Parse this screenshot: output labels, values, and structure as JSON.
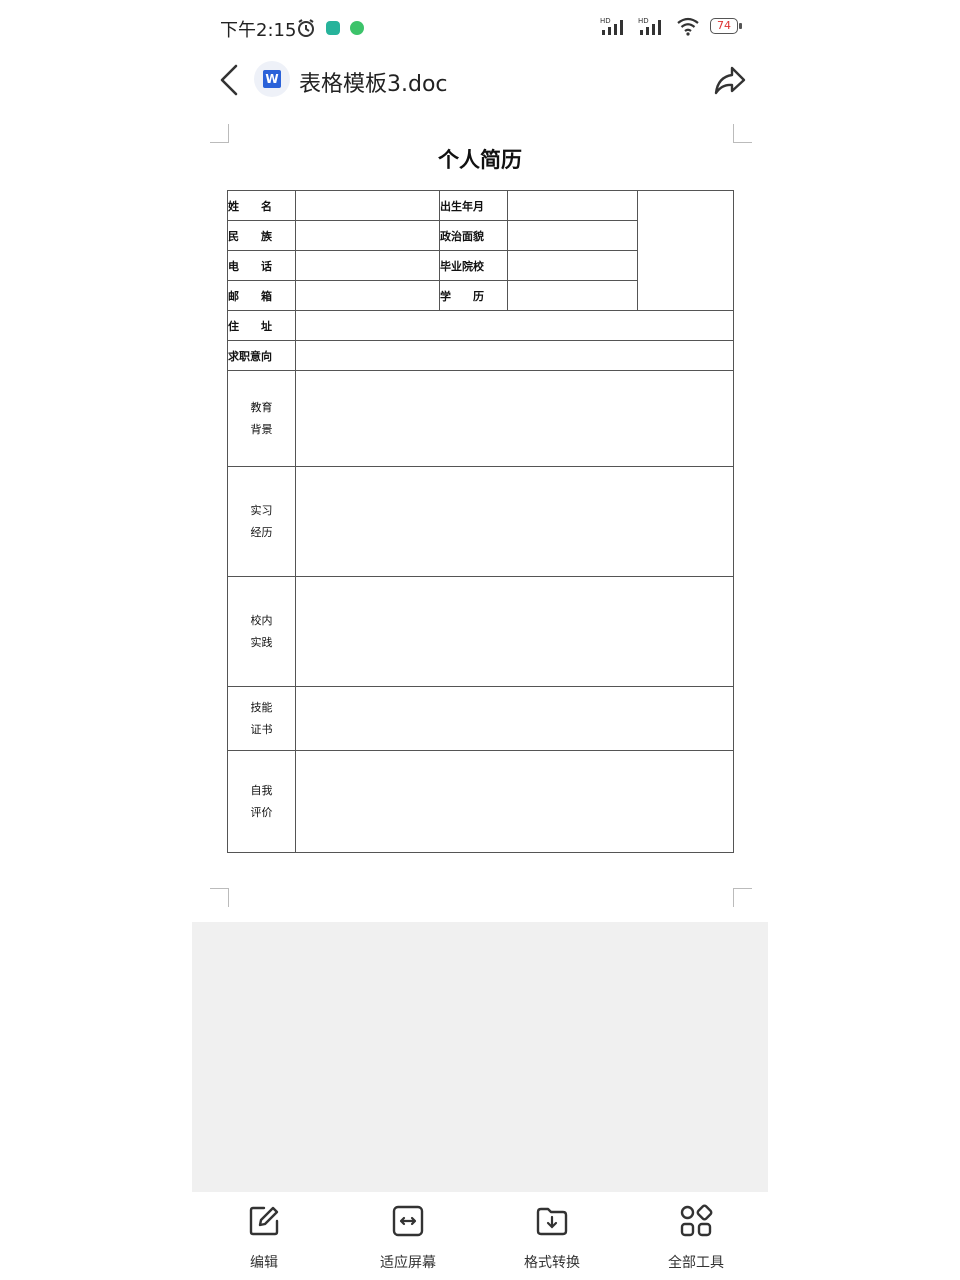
{
  "status_bar": {
    "time": "下午2:15",
    "battery": "74",
    "network": "HD"
  },
  "title_bar": {
    "doc_badge": "W",
    "title": "表格模板3.doc"
  },
  "document": {
    "heading": "个人简历",
    "info_rows": [
      {
        "label_a": "姓",
        "label_b": "名",
        "label2": "出生年月"
      },
      {
        "label_a": "民",
        "label_b": "族",
        "label2": "政治面貌"
      },
      {
        "label_a": "电",
        "label_b": "话",
        "label2": "毕业院校"
      },
      {
        "label_a": "邮",
        "label_b": "箱",
        "label2_a": "学",
        "label2_b": "历"
      }
    ],
    "address": {
      "label_a": "住",
      "label_b": "址"
    },
    "intention": "求职意向",
    "sections": [
      {
        "line1": "教育",
        "line2": "背景"
      },
      {
        "line1": "实习",
        "line2": "经历"
      },
      {
        "line1": "校内",
        "line2": "实践"
      },
      {
        "line1": "技能",
        "line2": "证书"
      },
      {
        "line1": "自我",
        "line2": "评价"
      }
    ]
  },
  "toolbar": {
    "edit": "编辑",
    "fit_screen": "适应屏幕",
    "convert": "格式转换",
    "all_tools": "全部工具"
  },
  "colors": {
    "doc_badge": "#2b62d9",
    "gray_pane": "#f0f0f0",
    "battery_text": "#dd3333"
  }
}
